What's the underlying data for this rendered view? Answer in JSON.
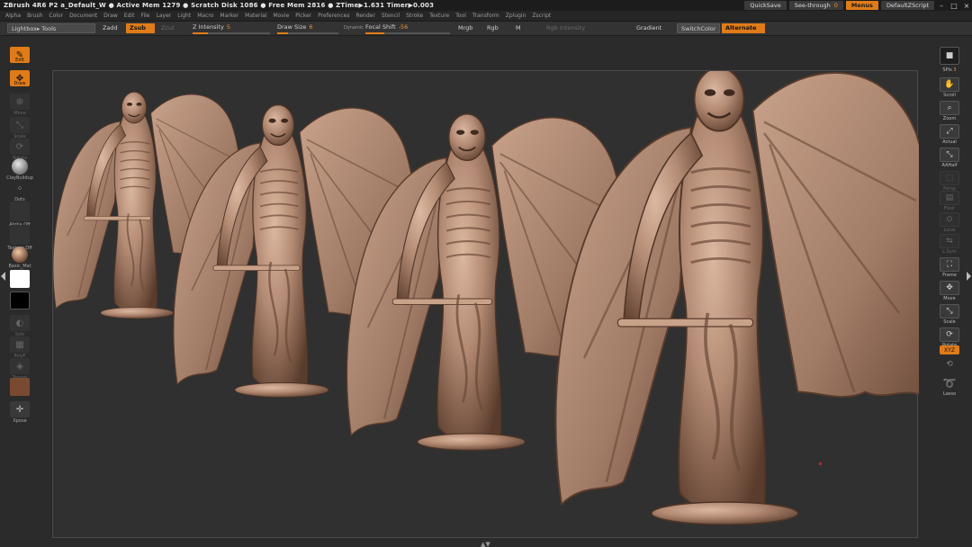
{
  "titlebar": {
    "title": "ZBrush 4R6 P2   a_Default_W   ● Active Mem 1279 ● Scratch Disk 1086 ● Free Mem 2816 ● ZTime▶1.631 Timer▶0.003",
    "quicksave": "QuickSave",
    "see_through_label": "See-through",
    "see_through_value": "0",
    "menus": "Menus",
    "default_zscript": "DefaultZScript"
  },
  "menubar": {
    "items": [
      "Alpha",
      "Brush",
      "Color",
      "Document",
      "Draw",
      "Edit",
      "File",
      "Layer",
      "Light",
      "Macro",
      "Marker",
      "Material",
      "Movie",
      "Picker",
      "Preferences",
      "Render",
      "Stencil",
      "Stroke",
      "Texture",
      "Tool",
      "Transform",
      "Zplugin",
      "Zscript"
    ]
  },
  "shelf": {
    "lightbox": "Lightbox▸ Tools",
    "zadd": "Zadd",
    "zsub": "Zsub",
    "zcut": "Zcut",
    "z_intensity_label": "Z Intensity",
    "z_intensity_value": "5",
    "draw_size_label": "Draw Size",
    "draw_size_value": "6",
    "dynamic": "Dynamic",
    "focal_shift_label": "Focal Shift",
    "focal_shift_value": "-56",
    "mrgb": "Mrgb",
    "rgb": "Rgb",
    "m": "M",
    "rgb_intensity": "Rgb Intensity",
    "gradient": "Gradient",
    "switchcolor": "SwitchColor",
    "alternate": "Alternate"
  },
  "lefttray": {
    "edit": "Edit",
    "draw": "Draw",
    "move": "Move",
    "scale": "Scale",
    "rotate": "Rotate",
    "brush": "ClayBuildup",
    "stroke": "Dots",
    "alpha": "Alpha Off",
    "texture": "Texture Off",
    "material": "Basic_Mat",
    "solo": "Solo",
    "polyf": "PolyF",
    "transp": "Transp",
    "xpose": "Xpose"
  },
  "righttray": {
    "spix_label": "SPix",
    "spix_value": "3",
    "scroll": "Scroll",
    "zoom": "Zoom",
    "actual": "Actual",
    "aahalf": "AAHalf",
    "persp": "Persp",
    "floor": "Floor",
    "local": "Local",
    "lsym": "L.Sym",
    "frame": "Frame",
    "move": "Move",
    "scale": "Scale",
    "rotate": "Rotate",
    "xyz": "XYZ",
    "lasso": "Lasso"
  },
  "colors": {
    "accent": "#e07b18",
    "background": "#2b2b2b",
    "viewport": "#303030",
    "clay": "#b38a73"
  },
  "sliders": {
    "z_intensity_fraction": 0.05,
    "draw_size_fraction": 0.06,
    "focal_shift_fraction": 0.22
  },
  "viewport": {
    "content": "Four winged demon sculpts rendered in clay material"
  }
}
